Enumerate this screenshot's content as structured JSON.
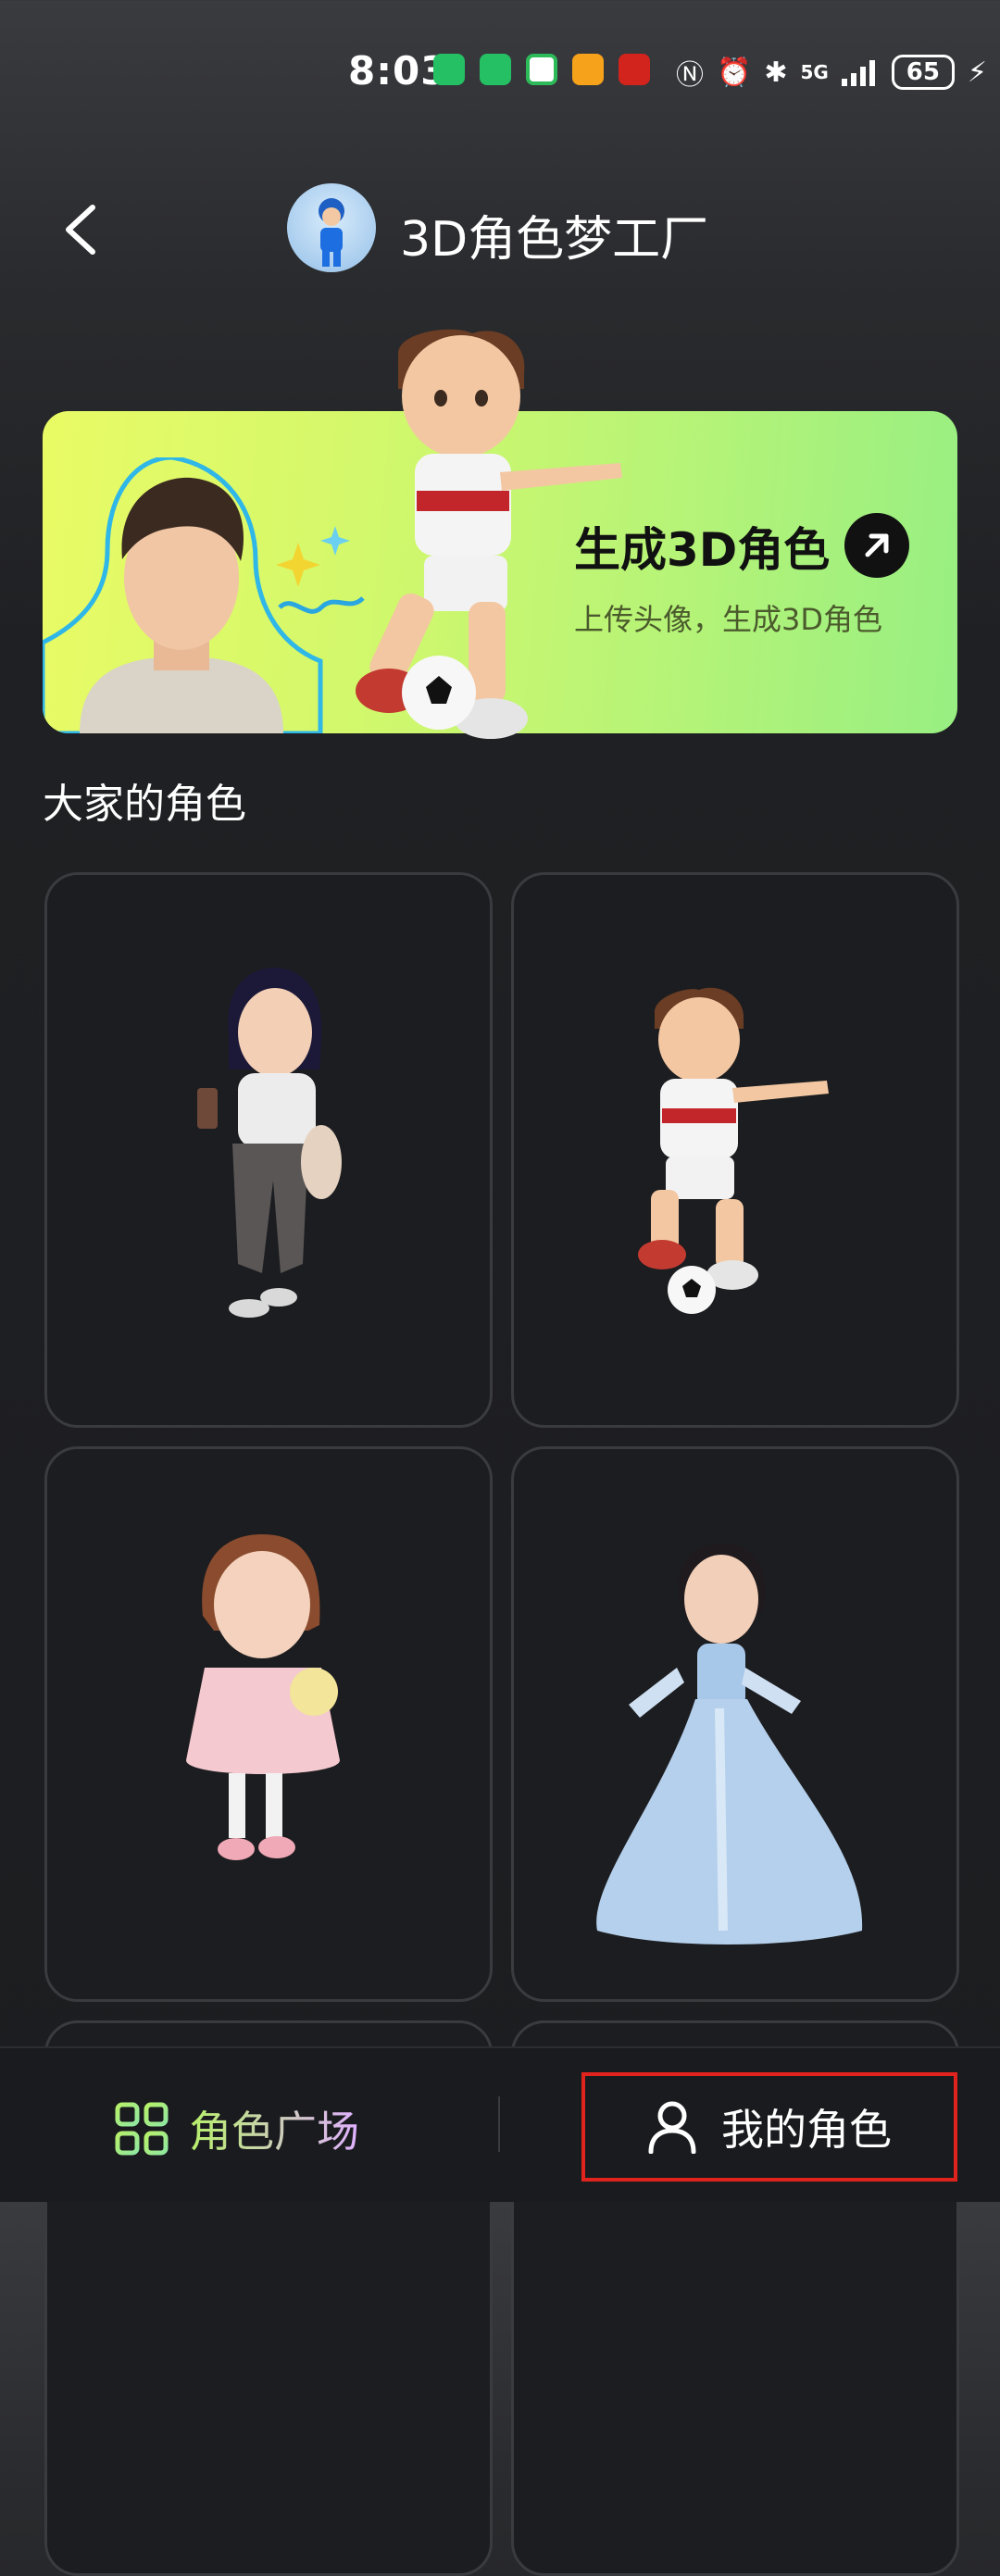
{
  "status_bar": {
    "time": "8:03",
    "battery": "65",
    "network": "5G"
  },
  "header": {
    "title": "3D角色梦工厂"
  },
  "banner": {
    "title": "生成3D角色",
    "subtitle": "上传头像，生成3D角色"
  },
  "section": {
    "title": "大家的角色"
  },
  "characters": [
    {
      "name": "girl-with-drink"
    },
    {
      "name": "boy-soccer-player"
    },
    {
      "name": "girl-pink-dress"
    },
    {
      "name": "girl-blue-gown"
    }
  ],
  "bottom_nav": {
    "plaza_label": "角色广场",
    "mine_label": "我的角色"
  },
  "colors": {
    "banner_start": "#e9fb65",
    "banner_end": "#98ef82",
    "highlight": "#e0231c"
  }
}
